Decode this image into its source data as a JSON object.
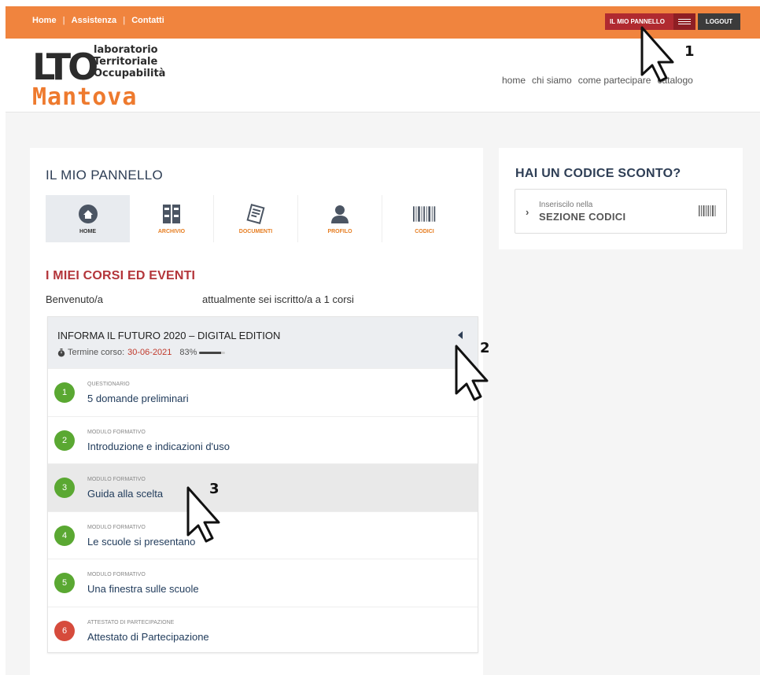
{
  "topbar": {
    "links": [
      "Home",
      "Assistenza",
      "Contatti"
    ],
    "panel_button": "IL MIO PANNELLO",
    "logout_button": "LOGOUT",
    "color": "#f0843e"
  },
  "logo": {
    "letters": "LTO",
    "words": [
      "laboratorio",
      "Territoriale",
      "Occupabilità"
    ],
    "city": "Mantova"
  },
  "main_nav": [
    "home",
    "chi siamo",
    "come partecipare",
    "catalogo"
  ],
  "panel": {
    "title": "IL MIO PANNELLO",
    "tiles": [
      {
        "label": "HOME",
        "icon": "home-icon",
        "active": true
      },
      {
        "label": "ARCHIVIO",
        "icon": "archive-icon",
        "active": false
      },
      {
        "label": "DOCUMENTI",
        "icon": "documents-icon",
        "active": false
      },
      {
        "label": "PROFILO",
        "icon": "profile-icon",
        "active": false
      },
      {
        "label": "CODICI",
        "icon": "barcode-icon",
        "active": false
      }
    ]
  },
  "courses": {
    "title": "I MIEI CORSI ED EVENTI",
    "welcome_start": "Benvenuto/a",
    "welcome_end": "attualmente sei iscritto/a a 1 corsi",
    "course": {
      "title": "INFORMA IL FUTURO 2020 – DIGITAL EDITION",
      "deadline_label": "Termine corso:",
      "deadline": "30-06-2021",
      "progress_text": "83%",
      "progress_fraction": 0.83,
      "modules": [
        {
          "num": "1",
          "type": "QUESTIONARIO",
          "title": "5 domande preliminari",
          "color": "#5aa832"
        },
        {
          "num": "2",
          "type": "MODULO FORMATIVO",
          "title": "Introduzione e indicazioni d'uso",
          "color": "#5aa832"
        },
        {
          "num": "3",
          "type": "MODULO FORMATIVO",
          "title": "Guida alla scelta",
          "color": "#5aa832"
        },
        {
          "num": "4",
          "type": "MODULO FORMATIVO",
          "title": "Le scuole si presentano",
          "color": "#5aa832"
        },
        {
          "num": "5",
          "type": "MODULO FORMATIVO",
          "title": "Una finestra sulle scuole",
          "color": "#5aa832"
        },
        {
          "num": "6",
          "type": "ATTESTATO DI PARTECIPAZIONE",
          "title": "Attestato di Partecipazione",
          "color": "#d64b3c"
        }
      ]
    }
  },
  "discount": {
    "title": "HAI UN CODICE SCONTO?",
    "line1": "Inseriscilo nella",
    "line2": "SEZIONE CODICI"
  },
  "cursors": [
    "1",
    "2",
    "3"
  ]
}
